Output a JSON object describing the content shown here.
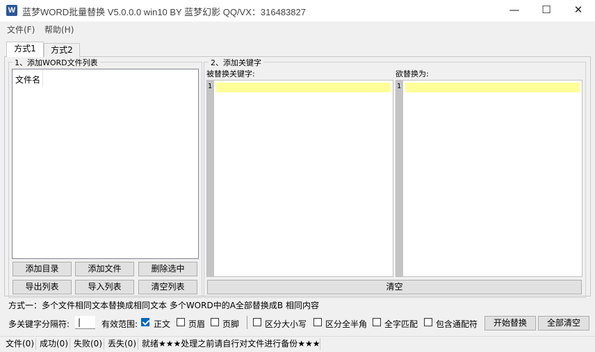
{
  "window": {
    "app_icon_letter": "W",
    "title": "蓝梦WORD批量替换 V5.0.0.0 win10 BY 蓝梦幻影 QQ/VX：316483827",
    "minimize_glyph": "—",
    "maximize_glyph": "☐",
    "close_glyph": "✕"
  },
  "menu": {
    "file": "文件(F)",
    "help": "帮助(H)"
  },
  "tabs": {
    "tab1": "方式1",
    "tab2": "方式2"
  },
  "file_group": {
    "legend": "1、添加WORD文件列表",
    "column_header": "文件名",
    "buttons": {
      "add_dir": "添加目录",
      "add_file": "添加文件",
      "delete_selected": "删除选中",
      "export_list": "导出列表",
      "import_list": "导入列表",
      "clear_list": "清空列表"
    }
  },
  "keyword_group": {
    "legend": "2、添加关键字",
    "find_label": "被替换关键字:",
    "replace_label": "欲替换为:",
    "find_line_number": "1",
    "replace_line_number": "1",
    "clear_button": "清空"
  },
  "mode_description": "方式一：多个文件相同文本替换成相同文本  多个WORD中的A全部替换成B 相同内容",
  "options": {
    "separator_label": "多关键字分隔符:",
    "separator_value": "|",
    "scope_label": "有效范围:",
    "body": {
      "label": "正文",
      "checked": true
    },
    "header": {
      "label": "页眉",
      "checked": false
    },
    "footer": {
      "label": "页脚",
      "checked": false
    },
    "case_sensitive": {
      "label": "区分大小写",
      "checked": false
    },
    "width_sensitive": {
      "label": "区分全半角",
      "checked": false
    },
    "whole_word": {
      "label": "全字匹配",
      "checked": false
    },
    "wildcard": {
      "label": "包含通配符",
      "checked": false
    },
    "start_button": "开始替换",
    "clear_all_button": "全部清空"
  },
  "status": {
    "files": "文件(0)",
    "success": "成功(0)",
    "failed": "失败(0)",
    "lost": "丢失(0)",
    "message": "就绪★★★处理之前请自行对文件进行备份★★★"
  }
}
